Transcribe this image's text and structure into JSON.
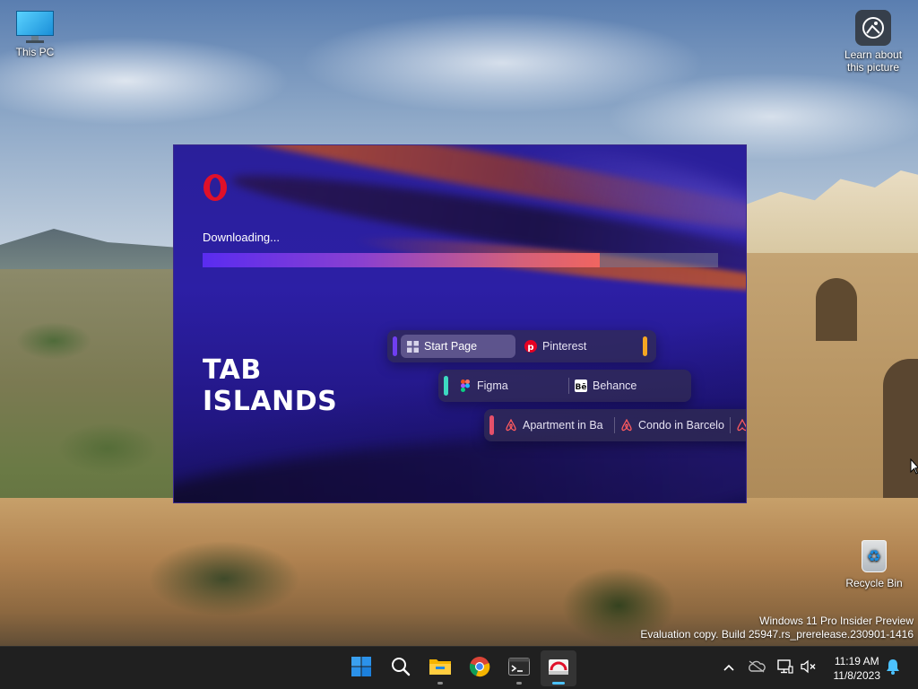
{
  "desktop": {
    "icons": [
      {
        "label": "This PC"
      },
      {
        "label": "Learn about this picture",
        "line1": "Learn about",
        "line2": "this picture"
      },
      {
        "label": "Recycle Bin"
      }
    ],
    "watermark": {
      "line1": "Windows 11 Pro Insider Preview",
      "line2": "Evaluation copy. Build 25947.rs_prerelease.230901-1416"
    }
  },
  "installer": {
    "brand_icon": "opera-logo",
    "status": "Downloading...",
    "progress": 0.77,
    "headline_line1": "TAB",
    "headline_line2": "ISLANDS",
    "islands": [
      {
        "accent_color": "#6f3ef0",
        "tabs": [
          {
            "label": "Start Page",
            "icon": "grid-icon",
            "active": true
          },
          {
            "label": "Pinterest",
            "icon": "pinterest-icon",
            "active": false
          }
        ],
        "trailing_accent": "#f5a623"
      },
      {
        "accent_color": "#3dd9c1",
        "tabs": [
          {
            "label": "Figma",
            "icon": "figma-icon",
            "active": false
          },
          {
            "label": "Behance",
            "icon": "behance-icon",
            "active": false
          }
        ]
      },
      {
        "accent_color": "#e5506a",
        "tabs": [
          {
            "label": "Apartment in Ba",
            "icon": "airbnb-icon",
            "active": false
          },
          {
            "label": "Condo in Barcelo",
            "icon": "airbnb-icon",
            "active": false
          }
        ]
      }
    ]
  },
  "taskbar": {
    "apps": [
      {
        "name": "Start",
        "icon": "windows-icon"
      },
      {
        "name": "Search",
        "icon": "search-icon"
      },
      {
        "name": "File Explorer",
        "icon": "folder-icon"
      },
      {
        "name": "Google Chrome",
        "icon": "chrome-icon"
      },
      {
        "name": "Terminal",
        "icon": "terminal-icon"
      },
      {
        "name": "Opera Installer",
        "icon": "opera-installer-icon",
        "active": true
      }
    ],
    "tray": [
      "chevron-up-icon",
      "onedrive-icon",
      "network-icon",
      "speaker-muted-icon"
    ],
    "clock": {
      "time": "11:19 AM",
      "date": "11/8/2023"
    },
    "notification_icon": "bell-icon"
  },
  "colors": {
    "installer_bg": "#2a1f9a",
    "progress_fill_end": "#f06560",
    "taskbar_bg": "#202020",
    "active_indicator": "#4cc2ff"
  }
}
